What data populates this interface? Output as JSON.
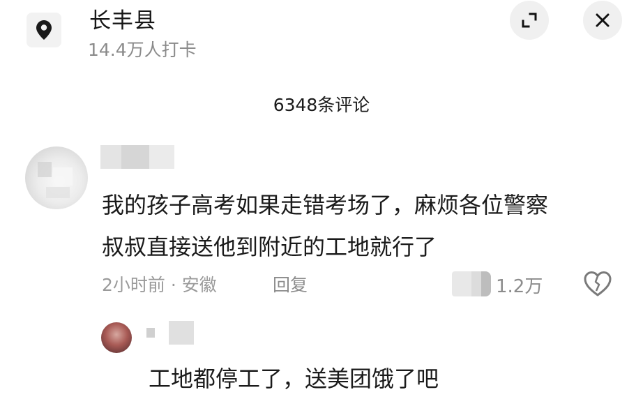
{
  "header": {
    "location_icon": "location-pin-icon",
    "place_name": "长丰县",
    "checkin_count": "14.4万人打卡",
    "expand_icon": "expand-icon",
    "close_icon": "close-icon"
  },
  "comments_header": {
    "count_label": "6348条评论"
  },
  "comment": {
    "text_line1": "我的孩子高考如果走错考场了，麻烦各位警察",
    "text_line2": "叔叔直接送他到附近的工地就行了",
    "time_location": "2小时前 · 安徽",
    "reply_label": "回复",
    "like_count": "1.2万",
    "like_icon": "heart-icon"
  },
  "reply": {
    "text": "工地都停工了，送美团饿了吧"
  },
  "colors": {
    "primary_text": "#1a1a1a",
    "secondary_text": "#8a8a8a",
    "button_bg": "#f0f0f0"
  }
}
